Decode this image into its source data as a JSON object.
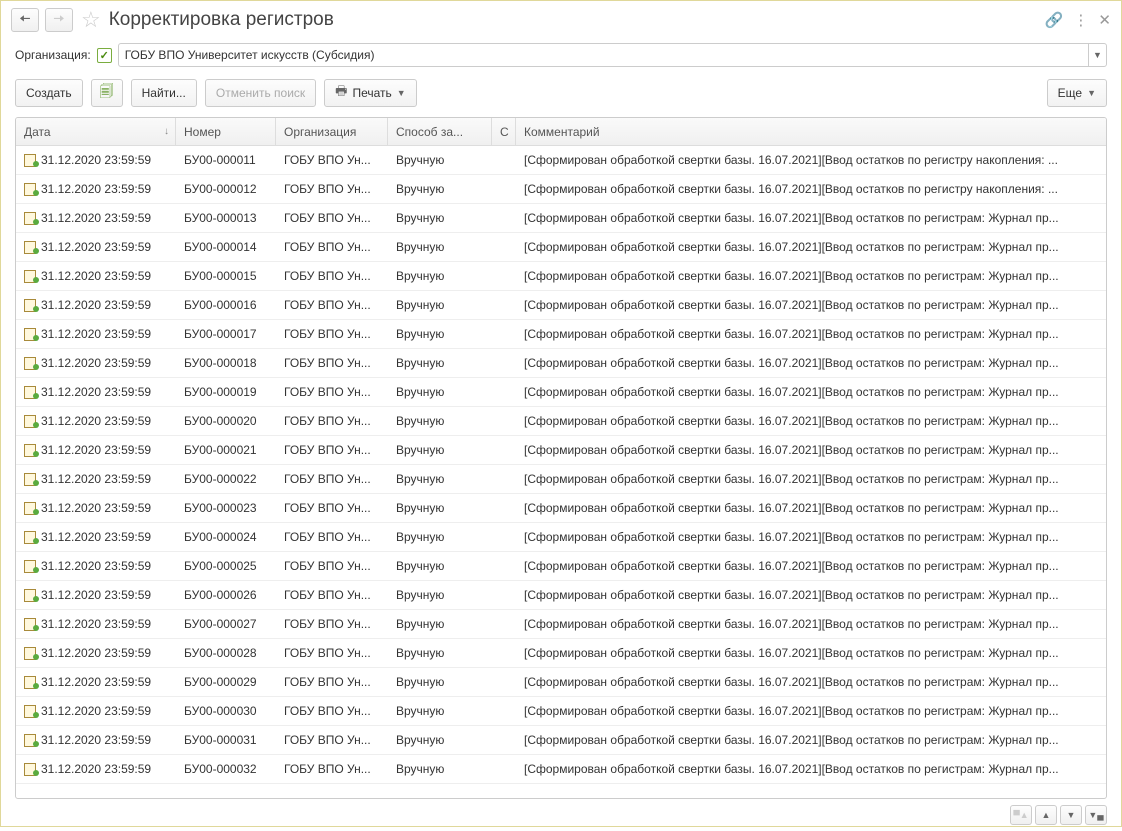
{
  "title": "Корректировка регистров",
  "filter": {
    "label": "Организация:",
    "value": "ГОБУ ВПО Университет искусств (Субсидия)"
  },
  "toolbar": {
    "create": "Создать",
    "find": "Найти...",
    "cancel_search": "Отменить поиск",
    "print": "Печать",
    "more": "Еще"
  },
  "columns": {
    "date": "Дата",
    "number": "Номер",
    "org": "Организация",
    "method": "Способ за...",
    "c": "С",
    "comment": "Комментарий"
  },
  "rows": [
    {
      "date": "31.12.2020 23:59:59",
      "num": "БУ00-000011",
      "org": "ГОБУ ВПО Ун...",
      "method": "Вручную",
      "comment": "[Сформирован обработкой свертки базы. 16.07.2021][Ввод остатков по регистру накопления: ..."
    },
    {
      "date": "31.12.2020 23:59:59",
      "num": "БУ00-000012",
      "org": "ГОБУ ВПО Ун...",
      "method": "Вручную",
      "comment": "[Сформирован обработкой свертки базы. 16.07.2021][Ввод остатков по регистру накопления: ..."
    },
    {
      "date": "31.12.2020 23:59:59",
      "num": "БУ00-000013",
      "org": "ГОБУ ВПО Ун...",
      "method": "Вручную",
      "comment": "[Сформирован обработкой свертки базы. 16.07.2021][Ввод остатков по регистрам: Журнал пр..."
    },
    {
      "date": "31.12.2020 23:59:59",
      "num": "БУ00-000014",
      "org": "ГОБУ ВПО Ун...",
      "method": "Вручную",
      "comment": "[Сформирован обработкой свертки базы. 16.07.2021][Ввод остатков по регистрам: Журнал пр..."
    },
    {
      "date": "31.12.2020 23:59:59",
      "num": "БУ00-000015",
      "org": "ГОБУ ВПО Ун...",
      "method": "Вручную",
      "comment": "[Сформирован обработкой свертки базы. 16.07.2021][Ввод остатков по регистрам: Журнал пр..."
    },
    {
      "date": "31.12.2020 23:59:59",
      "num": "БУ00-000016",
      "org": "ГОБУ ВПО Ун...",
      "method": "Вручную",
      "comment": "[Сформирован обработкой свертки базы. 16.07.2021][Ввод остатков по регистрам: Журнал пр..."
    },
    {
      "date": "31.12.2020 23:59:59",
      "num": "БУ00-000017",
      "org": "ГОБУ ВПО Ун...",
      "method": "Вручную",
      "comment": "[Сформирован обработкой свертки базы. 16.07.2021][Ввод остатков по регистрам: Журнал пр..."
    },
    {
      "date": "31.12.2020 23:59:59",
      "num": "БУ00-000018",
      "org": "ГОБУ ВПО Ун...",
      "method": "Вручную",
      "comment": "[Сформирован обработкой свертки базы. 16.07.2021][Ввод остатков по регистрам: Журнал пр..."
    },
    {
      "date": "31.12.2020 23:59:59",
      "num": "БУ00-000019",
      "org": "ГОБУ ВПО Ун...",
      "method": "Вручную",
      "comment": "[Сформирован обработкой свертки базы. 16.07.2021][Ввод остатков по регистрам: Журнал пр..."
    },
    {
      "date": "31.12.2020 23:59:59",
      "num": "БУ00-000020",
      "org": "ГОБУ ВПО Ун...",
      "method": "Вручную",
      "comment": "[Сформирован обработкой свертки базы. 16.07.2021][Ввод остатков по регистрам: Журнал пр..."
    },
    {
      "date": "31.12.2020 23:59:59",
      "num": "БУ00-000021",
      "org": "ГОБУ ВПО Ун...",
      "method": "Вручную",
      "comment": "[Сформирован обработкой свертки базы. 16.07.2021][Ввод остатков по регистрам: Журнал пр..."
    },
    {
      "date": "31.12.2020 23:59:59",
      "num": "БУ00-000022",
      "org": "ГОБУ ВПО Ун...",
      "method": "Вручную",
      "comment": "[Сформирован обработкой свертки базы. 16.07.2021][Ввод остатков по регистрам: Журнал пр..."
    },
    {
      "date": "31.12.2020 23:59:59",
      "num": "БУ00-000023",
      "org": "ГОБУ ВПО Ун...",
      "method": "Вручную",
      "comment": "[Сформирован обработкой свертки базы. 16.07.2021][Ввод остатков по регистрам: Журнал пр..."
    },
    {
      "date": "31.12.2020 23:59:59",
      "num": "БУ00-000024",
      "org": "ГОБУ ВПО Ун...",
      "method": "Вручную",
      "comment": "[Сформирован обработкой свертки базы. 16.07.2021][Ввод остатков по регистрам: Журнал пр..."
    },
    {
      "date": "31.12.2020 23:59:59",
      "num": "БУ00-000025",
      "org": "ГОБУ ВПО Ун...",
      "method": "Вручную",
      "comment": "[Сформирован обработкой свертки базы. 16.07.2021][Ввод остатков по регистрам: Журнал пр..."
    },
    {
      "date": "31.12.2020 23:59:59",
      "num": "БУ00-000026",
      "org": "ГОБУ ВПО Ун...",
      "method": "Вручную",
      "comment": "[Сформирован обработкой свертки базы. 16.07.2021][Ввод остатков по регистрам: Журнал пр..."
    },
    {
      "date": "31.12.2020 23:59:59",
      "num": "БУ00-000027",
      "org": "ГОБУ ВПО Ун...",
      "method": "Вручную",
      "comment": "[Сформирован обработкой свертки базы. 16.07.2021][Ввод остатков по регистрам: Журнал пр..."
    },
    {
      "date": "31.12.2020 23:59:59",
      "num": "БУ00-000028",
      "org": "ГОБУ ВПО Ун...",
      "method": "Вручную",
      "comment": "[Сформирован обработкой свертки базы. 16.07.2021][Ввод остатков по регистрам: Журнал пр..."
    },
    {
      "date": "31.12.2020 23:59:59",
      "num": "БУ00-000029",
      "org": "ГОБУ ВПО Ун...",
      "method": "Вручную",
      "comment": "[Сформирован обработкой свертки базы. 16.07.2021][Ввод остатков по регистрам: Журнал пр..."
    },
    {
      "date": "31.12.2020 23:59:59",
      "num": "БУ00-000030",
      "org": "ГОБУ ВПО Ун...",
      "method": "Вручную",
      "comment": "[Сформирован обработкой свертки базы. 16.07.2021][Ввод остатков по регистрам: Журнал пр..."
    },
    {
      "date": "31.12.2020 23:59:59",
      "num": "БУ00-000031",
      "org": "ГОБУ ВПО Ун...",
      "method": "Вручную",
      "comment": "[Сформирован обработкой свертки базы. 16.07.2021][Ввод остатков по регистрам: Журнал пр..."
    },
    {
      "date": "31.12.2020 23:59:59",
      "num": "БУ00-000032",
      "org": "ГОБУ ВПО Ун...",
      "method": "Вручную",
      "comment": "[Сформирован обработкой свертки базы. 16.07.2021][Ввод остатков по регистрам: Журнал пр..."
    }
  ]
}
